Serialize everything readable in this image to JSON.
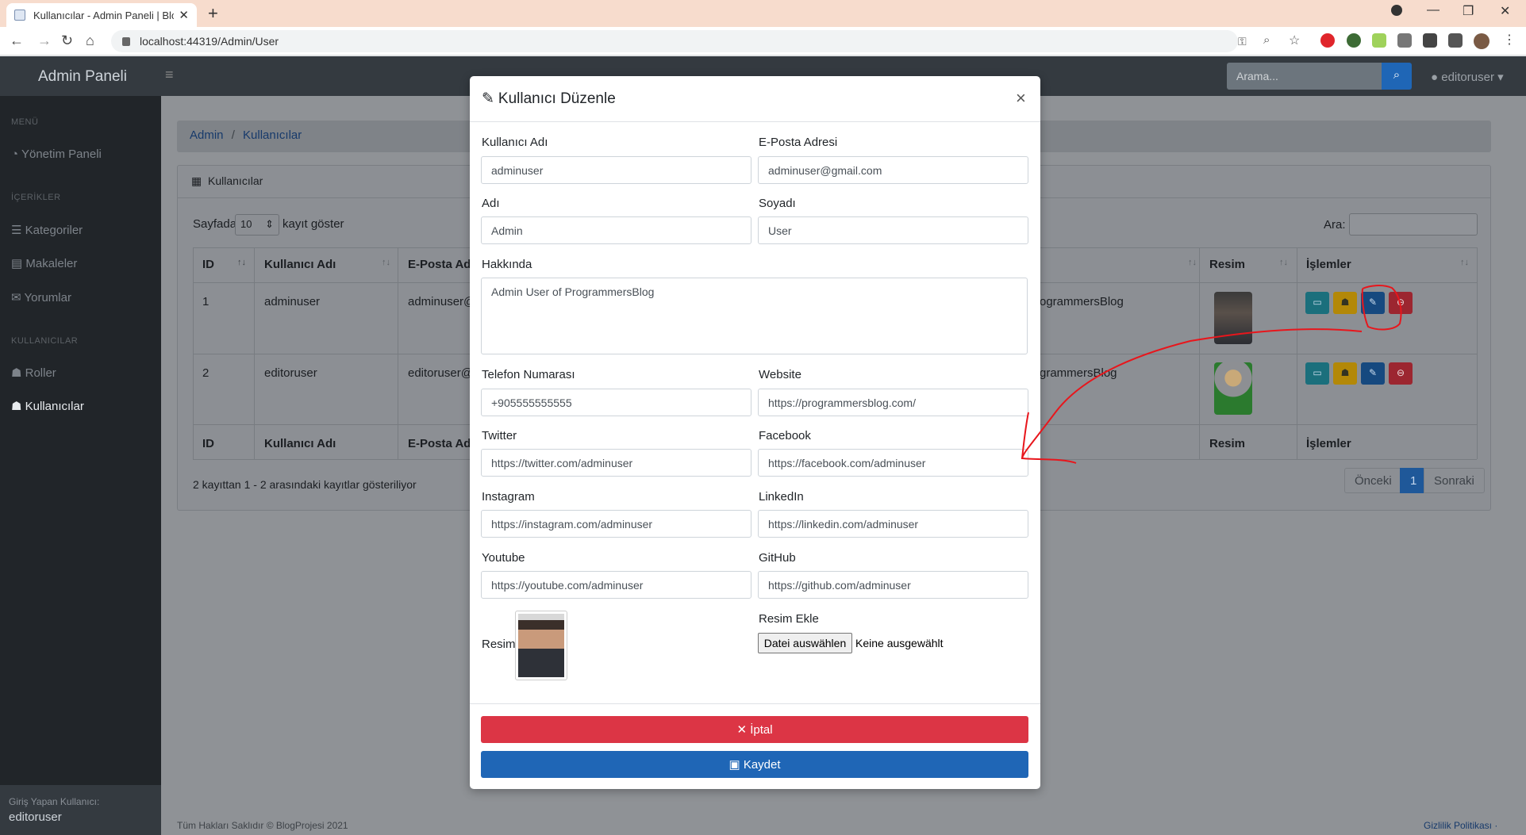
{
  "browser": {
    "tab_title": "Kullanıcılar - Admin Paneli | Blog",
    "url": "localhost:44319/Admin/User"
  },
  "navbar": {
    "brand": "Admin Paneli",
    "search_placeholder": "Arama...",
    "user": "editoruser"
  },
  "sidebar": {
    "section_menu": "MENÜ",
    "dashboard": "Yönetim Paneli",
    "section_content": "İÇERİKLER",
    "categories": "Kategoriler",
    "articles": "Makaleler",
    "comments": "Yorumlar",
    "section_users": "KULLANICILAR",
    "roles": "Roller",
    "users": "Kullanıcılar",
    "footer_label": "Giriş Yapan Kullanıcı:",
    "footer_user": "editoruser"
  },
  "breadcrumb": {
    "root": "Admin",
    "separator": "/",
    "current": "Kullanıcılar"
  },
  "card": {
    "title": "Kullanıcılar",
    "show_prefix": "Sayfada",
    "page_size": "10",
    "show_suffix": "kayıt göster",
    "search_label": "Ara:",
    "info": "2 kayıttan 1 - 2 arasındaki kayıtlar gösteriliyor",
    "prev": "Önceki",
    "page": "1",
    "next": "Sonraki"
  },
  "table": {
    "headers": {
      "id": "ID",
      "username": "Kullanıcı Adı",
      "email": "E-Posta Adr",
      "about": "",
      "picture": "Resim",
      "actions": "İşlemler"
    },
    "rows": [
      {
        "id": "1",
        "username": "adminuser",
        "email": "adminuser@",
        "about": "ogrammersBlog"
      },
      {
        "id": "2",
        "username": "editoruser",
        "email": "editoruser@",
        "about": "grammersBlog"
      }
    ]
  },
  "modal": {
    "title": "Kullanıcı Düzenle",
    "close": "×",
    "username_label": "Kullanıcı Adı",
    "username": "adminuser",
    "email_label": "E-Posta Adresi",
    "email": "adminuser@gmail.com",
    "firstname_label": "Adı",
    "firstname": "Admin",
    "lastname_label": "Soyadı",
    "lastname": "User",
    "about_label": "Hakkında",
    "about": "Admin User of ProgrammersBlog",
    "phone_label": "Telefon Numarası",
    "phone": "+905555555555",
    "website_label": "Website",
    "website": "https://programmersblog.com/",
    "twitter_label": "Twitter",
    "twitter": "https://twitter.com/adminuser",
    "facebook_label": "Facebook",
    "facebook": "https://facebook.com/adminuser",
    "instagram_label": "Instagram",
    "instagram": "https://instagram.com/adminuser",
    "linkedin_label": "LinkedIn",
    "linkedin": "https://linkedin.com/adminuser",
    "youtube_label": "Youtube",
    "youtube": "https://youtube.com/adminuser",
    "github_label": "GitHub",
    "github": "https://github.com/adminuser",
    "picture_label": "Resim",
    "add_picture_label": "Resim Ekle",
    "file_button": "Datei auswählen",
    "file_status": "Keine ausgewählt",
    "cancel": "İptal",
    "save": "Kaydet"
  },
  "footer": {
    "copyright": "Tüm Hakları Saklıdır © BlogProjesi 2021",
    "privacy": "Gizlilik Politikası ·"
  },
  "colors": {
    "danger": "#dc3545",
    "primary": "#1f66b6",
    "info": "#17a2b8",
    "warning": "#ffc107",
    "annotation": "#e8161c"
  }
}
